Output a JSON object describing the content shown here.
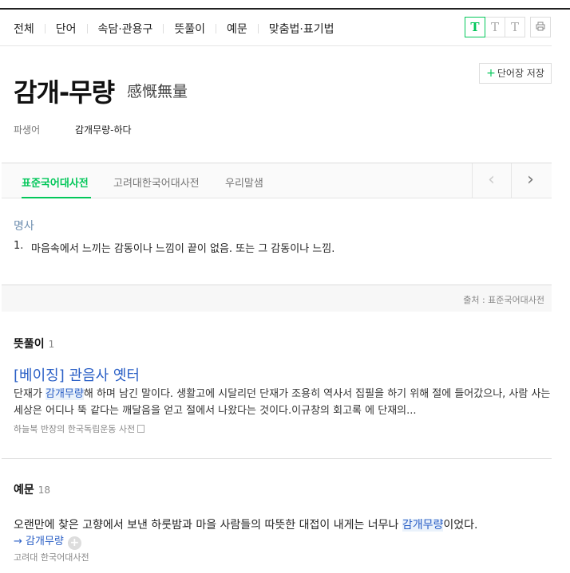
{
  "nav": {
    "tabs": [
      "전체",
      "단어",
      "속담·관용구",
      "뜻풀이",
      "예문",
      "맞춤법·표기법"
    ],
    "font_buttons": [
      "T",
      "T",
      "T"
    ],
    "print_icon": "print-icon"
  },
  "entry": {
    "title": "감개-무량",
    "hanja": "感慨無量",
    "save_label": "단어장 저장",
    "derivative_label": "파생어",
    "derivative_value": "감개무량-하다"
  },
  "dict_tabs": [
    "표준국어대사전",
    "고려대한국어대사전",
    "우리말샘"
  ],
  "definition": {
    "pos": "명사",
    "number": "1.",
    "text": "마음속에서 느끼는 감동이나 느낌이 끝이 없음. 또는 그 감동이나 느낌.",
    "source": "출처 : 표준국어대사전"
  },
  "meaning_section": {
    "title": "뜻풀이",
    "count": "1",
    "article_title": "[베이징] 관음사 옛터",
    "body_before": "단재가 ",
    "body_highlight": "감개무량",
    "body_after": "해 하며 남긴 말이다. 생활고에 시달리던 단재가 조용히 역사서 집필을 하기 위해 절에 들어갔으나, 사람 사는 세상은 어디나 뚝 같다는 깨달음을 얻고 절에서 나왔다는 것이다.이규창의 회고록 에 단재의...",
    "source": "하늘북 반장의 한국독립운동 사전"
  },
  "example_section": {
    "title": "예문",
    "count": "18",
    "sentence_before": "오랜만에 찾은 고향에서 보낸 하룻밤과 마을 사람들의 따뜻한 대접이 내게는 너무나 ",
    "sentence_highlight": "감개무량",
    "sentence_after": "이었다.",
    "link": "→ 감개무량",
    "source": "고려대 한국어대사전"
  }
}
